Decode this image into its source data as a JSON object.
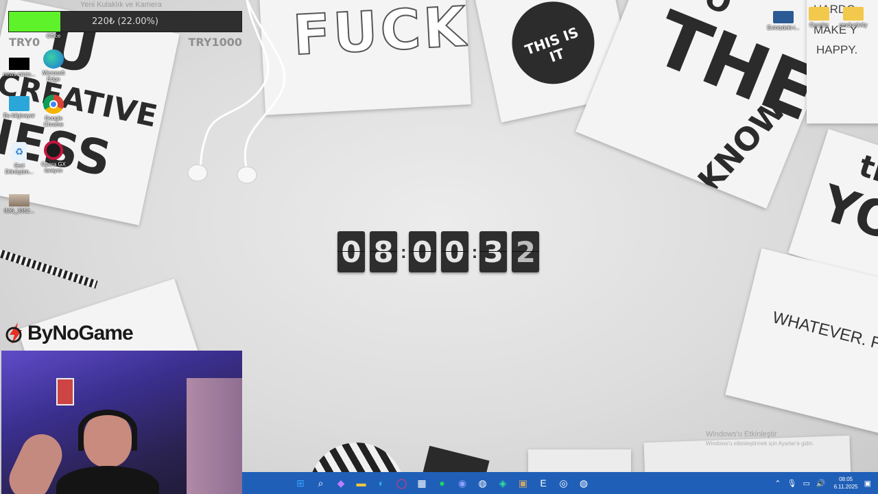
{
  "goal": {
    "title": "Yeni Kulaklık ve Kamera",
    "progress_text": "220₺ (22.00%)",
    "progress_fraction": 0.22,
    "min_label": "TRY0",
    "max_label": "TRY1000",
    "fill_color": "#5df22a"
  },
  "desktop_icons_left": [
    {
      "label": "Office",
      "icon": "office-icon"
    },
    {
      "label": "news.minin...",
      "icon": "news-icon"
    },
    {
      "label": "Microsoft Edge",
      "icon": "edge-icon"
    },
    {
      "label": "Bu bilgisayar",
      "icon": "computer-icon"
    },
    {
      "label": "Google Chrome",
      "icon": "chrome-icon"
    },
    {
      "label": "Geri Dönüşüm...",
      "icon": "recycle-bin-icon"
    },
    {
      "label": "Opera GX tarayıcı",
      "icon": "opera-gx-icon"
    },
    {
      "label": "IMG_3352...",
      "icon": "image-file-icon"
    }
  ],
  "desktop_icons_right": [
    {
      "label": "Evinizdeki-i...",
      "icon": "folder-icon"
    },
    {
      "label": "Oyunlar",
      "icon": "folder-icon"
    },
    {
      "label": "productivity",
      "icon": "folder-icon"
    }
  ],
  "wallpaper_text": {
    "fuck": "FUCK",
    "this_is_it": "THIS IS IT",
    "the": "THE",
    "impo": "IMPO",
    "know": "KNOW",
    "creative": "CREATIVE",
    "ness": "NESS",
    "happy": "HAPPY.",
    "make": "MAKE Y",
    "hardc": "HARDC",
    "whatever": "WHATEVER. FU",
    "yo": "YO",
    "th": "th",
    "u": "U"
  },
  "clock": {
    "digits": [
      "0",
      "8",
      "0",
      "0",
      "3",
      "2"
    ],
    "separator": ":"
  },
  "logo": {
    "text": "ByNoGame"
  },
  "activation": {
    "title": "Windows'u Etkinleştir",
    "subtitle": "Windows'u etkinleştirmek için Ayarlar'a gidin."
  },
  "taskbar": {
    "apps": [
      {
        "name": "start-icon",
        "glyph": "⊞",
        "color": "#3aa0ff"
      },
      {
        "name": "search-icon",
        "glyph": "⌕",
        "color": "#ffffff"
      },
      {
        "name": "copilot-icon",
        "glyph": "◆",
        "color": "#c07cff"
      },
      {
        "name": "file-explorer-icon",
        "glyph": "▬",
        "color": "#f3c53d"
      },
      {
        "name": "edge-icon",
        "glyph": "◐",
        "color": "#2fb3e6"
      },
      {
        "name": "opera-gx-icon",
        "glyph": "◯",
        "color": "#ff2f6d"
      },
      {
        "name": "store-icon",
        "glyph": "▦",
        "color": "#ffffff"
      },
      {
        "name": "spotify-icon",
        "glyph": "●",
        "color": "#1ed760"
      },
      {
        "name": "discord-icon",
        "glyph": "◉",
        "color": "#8ea1ff"
      },
      {
        "name": "steam-icon",
        "glyph": "◍",
        "color": "#ffffff"
      },
      {
        "name": "app-icon",
        "glyph": "◈",
        "color": "#2ee0a0"
      },
      {
        "name": "minecraft-icon",
        "glyph": "▣",
        "color": "#c8a46a"
      },
      {
        "name": "epic-games-icon",
        "glyph": "E",
        "color": "#ffffff"
      },
      {
        "name": "obs-icon",
        "glyph": "◎",
        "color": "#ffffff"
      },
      {
        "name": "steam-icon-2",
        "glyph": "◍",
        "color": "#ffffff"
      }
    ],
    "time": "08:05",
    "date": "6.11.2025",
    "color": "#1f5fb8"
  }
}
